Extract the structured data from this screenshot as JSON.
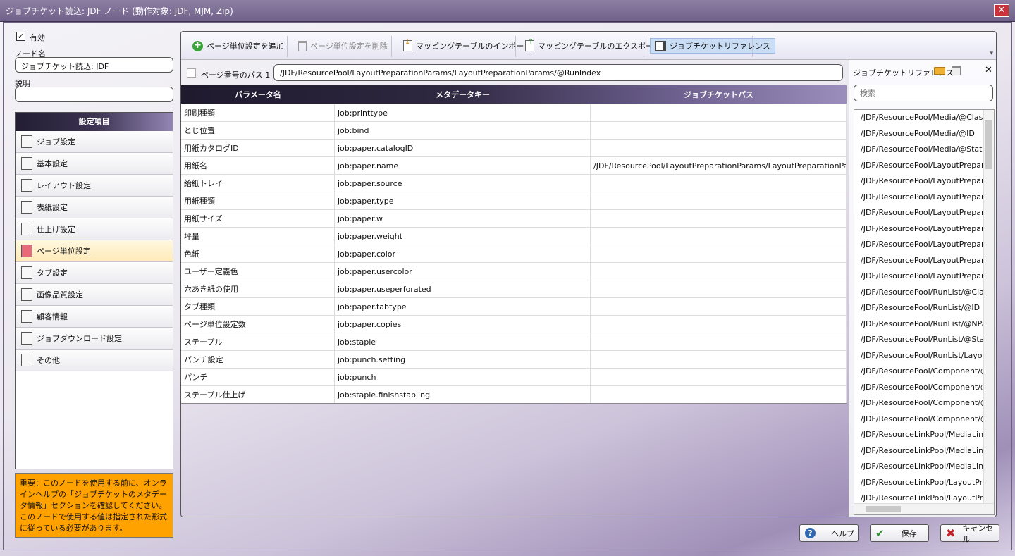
{
  "window": {
    "title": "ジョブチケット読込: JDF ノード (動作対象: JDF, MJM, Zip)",
    "close": "✕"
  },
  "left": {
    "enabled_check": "✓",
    "enabled_label": "有効",
    "node_name_label": "ノード名",
    "node_name_value": "ジョブチケット読込: JDF",
    "desc_label": "説明",
    "desc_value": ""
  },
  "settings": {
    "header": "設定項目",
    "items": [
      {
        "label": "ジョブ設定",
        "icon": "document-icon"
      },
      {
        "label": "基本設定",
        "icon": "list-icon"
      },
      {
        "label": "レイアウト設定",
        "icon": "layout-icon"
      },
      {
        "label": "表紙設定",
        "icon": "cover-icon"
      },
      {
        "label": "仕上げ設定",
        "icon": "finishing-icon"
      },
      {
        "label": "ページ単位設定",
        "icon": "pages-icon"
      },
      {
        "label": "タブ設定",
        "icon": "tab-icon"
      },
      {
        "label": "画像品質設定",
        "icon": "image-icon"
      },
      {
        "label": "顧客情報",
        "icon": "customer-icon"
      },
      {
        "label": "ジョブダウンロード設定",
        "icon": "download-icon"
      },
      {
        "label": "その他",
        "icon": "other-icon"
      }
    ]
  },
  "notice": "重要：このノードを使用する前に、オンラインヘルプの「ジョブチケットのメタデータ情報」セクションを確認してください。このノードで使用する値は指定された形式に従っている必要があります。",
  "toolbar": {
    "add": "ページ単位設定を追加",
    "delete": "ページ単位設定を削除",
    "import": "マッピングテーブルのインポート",
    "export": "マッピングテーブルのエクスポート",
    "reference": "ジョブチケットリファレンス",
    "overflow": "▾"
  },
  "path": {
    "label": "ページ番号のパス 1",
    "value": "/JDF/ResourcePool/LayoutPreparationParams/LayoutPreparationParams/@RunIndex"
  },
  "grid": {
    "headers": [
      "パラメータ名",
      "メタデータキー",
      "ジョブチケットパス"
    ],
    "rows": [
      [
        "印刷種類",
        "job:printtype",
        ""
      ],
      [
        "とじ位置",
        "job:bind",
        ""
      ],
      [
        "用紙カタログID",
        "job:paper.catalogID",
        ""
      ],
      [
        "用紙名",
        "job:paper.name",
        "/JDF/ResourcePool/LayoutPreparationParams/LayoutPreparationParam"
      ],
      [
        "給紙トレイ",
        "job:paper.source",
        ""
      ],
      [
        "用紙種類",
        "job:paper.type",
        ""
      ],
      [
        "用紙サイズ",
        "job:paper.w",
        ""
      ],
      [
        "坪量",
        "job:paper.weight",
        ""
      ],
      [
        "色紙",
        "job:paper.color",
        ""
      ],
      [
        "ユーザー定義色",
        "job:paper.usercolor",
        ""
      ],
      [
        "穴あき紙の使用",
        "job:paper.useperforated",
        ""
      ],
      [
        "タブ種類",
        "job:paper.tabtype",
        ""
      ],
      [
        "ページ単位設定数",
        "job:paper.copies",
        ""
      ],
      [
        "ステープル",
        "job:staple",
        ""
      ],
      [
        "パンチ設定",
        "job:punch.setting",
        ""
      ],
      [
        "パンチ",
        "job:punch",
        ""
      ],
      [
        "ステープル仕上げ",
        "job:staple.finishstapling",
        ""
      ]
    ]
  },
  "reference": {
    "title": "ジョブチケットリファレンス",
    "close": "✕",
    "search_placeholder": "検索",
    "items": [
      "/JDF/ResourcePool/Media/@Class",
      "/JDF/ResourcePool/Media/@ID",
      "/JDF/ResourcePool/Media/@Status",
      "/JDF/ResourcePool/LayoutPrepara",
      "/JDF/ResourcePool/LayoutPrepara",
      "/JDF/ResourcePool/LayoutPrepara",
      "/JDF/ResourcePool/LayoutPrepara",
      "/JDF/ResourcePool/LayoutPrepara",
      "/JDF/ResourcePool/LayoutPrepara",
      "/JDF/ResourcePool/LayoutPrepara",
      "/JDF/ResourcePool/LayoutPrepara",
      "/JDF/ResourcePool/RunList/@Class",
      "/JDF/ResourcePool/RunList/@ID",
      "/JDF/ResourcePool/RunList/@NPa",
      "/JDF/ResourcePool/RunList/@Stat",
      "/JDF/ResourcePool/RunList/Layou",
      "/JDF/ResourcePool/Component/@",
      "/JDF/ResourcePool/Component/@",
      "/JDF/ResourcePool/Component/@",
      "/JDF/ResourcePool/Component/@",
      "/JDF/ResourceLinkPool/MediaLink",
      "/JDF/ResourceLinkPool/MediaLink",
      "/JDF/ResourceLinkPool/MediaLink",
      "/JDF/ResourceLinkPool/LayoutPre",
      "/JDF/ResourceLinkPool/LayoutPre"
    ]
  },
  "buttons": {
    "help": "ヘルプ",
    "save": "保存",
    "cancel": "キャンセル"
  },
  "colors": {
    "accent": "#9485b4",
    "notice": "#ffa200",
    "selected": "#ffeab8"
  }
}
